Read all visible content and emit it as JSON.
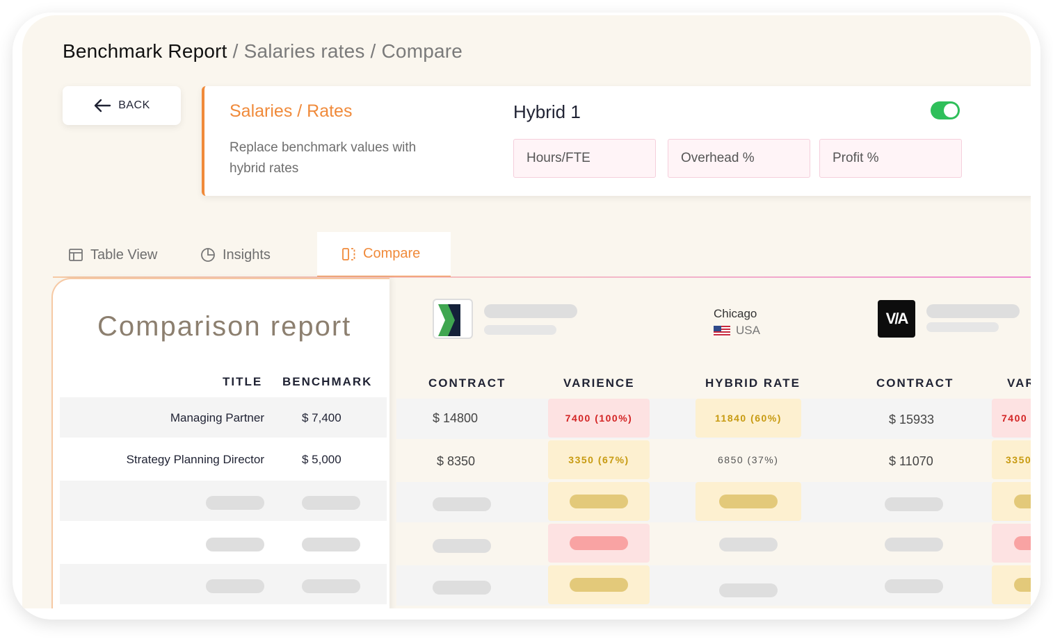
{
  "breadcrumb": {
    "main": "Benchmark Report",
    "rest": " / Salaries rates / Compare",
    "sep": " /"
  },
  "back_button": {
    "label": "BACK",
    "icon": "arrow-left-icon"
  },
  "settings": {
    "title": "Salaries / Rates",
    "description": "Replace benchmark values with hybrid rates",
    "hybrid_title": "Hybrid 1",
    "toggle_on": true,
    "fields": [
      "Hours/FTE",
      "Overhead %",
      "Profit %"
    ]
  },
  "tabs": [
    {
      "label": "Table View",
      "icon": "table-icon",
      "active": false
    },
    {
      "label": "Insights",
      "icon": "pie-chart-icon",
      "active": false
    },
    {
      "label": "Compare",
      "icon": "compare-columns-icon",
      "active": true
    }
  ],
  "comparison": {
    "title": "Comparison report",
    "headers": {
      "title": "TITLE",
      "benchmark": "BENCHMARK"
    },
    "rows": [
      {
        "title": "Managing Partner",
        "benchmark": "$ 7,400"
      },
      {
        "title": "Strategy Planning Director",
        "benchmark": "$ 5,000"
      }
    ]
  },
  "location": {
    "city": "Chicago",
    "country": "USA",
    "flag_icon": "us-flag-icon"
  },
  "company2_logo_text": "V/A",
  "columns": {
    "contract": "CONTRACT",
    "variance": "VARIENCE",
    "hybrid": "HYBRID RATE",
    "contract2": "CONTRACT",
    "variance2_partial": "VAR"
  },
  "compare_rows": [
    {
      "contract": "$ 14800",
      "variance": "7400 (100%)",
      "hybrid": "11840 (60%)",
      "contract2": "$ 15933",
      "variance2_partial": "7400"
    },
    {
      "contract": "$ 8350",
      "variance": "3350 (67%)",
      "hybrid": "6850 (37%)",
      "contract2": "$ 11070",
      "variance2_partial": "3350"
    }
  ],
  "colors": {
    "accent": "#f08a3a",
    "toggle": "#2fbf5a",
    "red_bg": "#fde2e2",
    "red_text": "#d32424",
    "yellow_bg": "#fdf0d0",
    "yellow_text": "#c79a10"
  }
}
